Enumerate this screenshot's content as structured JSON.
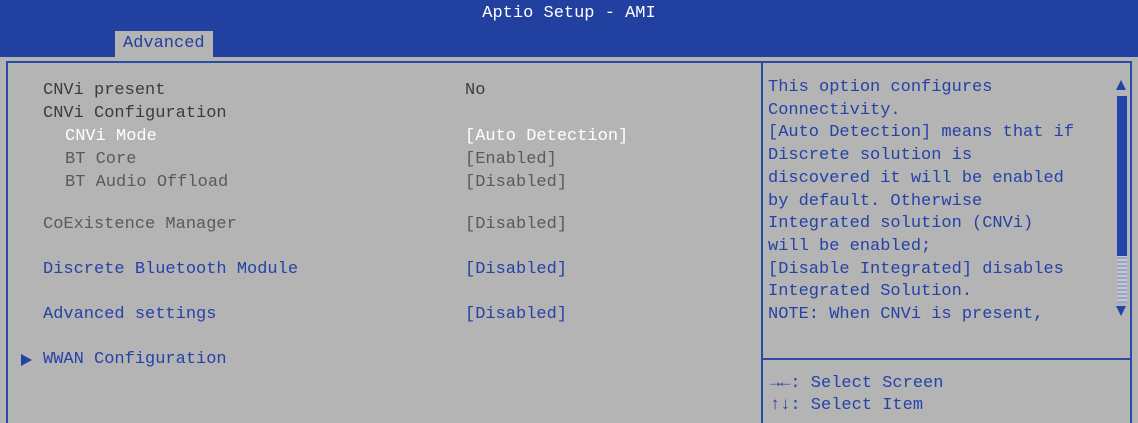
{
  "window": {
    "title": "Aptio Setup - AMI"
  },
  "tabs": [
    {
      "label": "Advanced",
      "active": true
    }
  ],
  "settings": [
    {
      "label": "CNVi present",
      "value": "No"
    },
    {
      "label": "CNVi Configuration",
      "value": ""
    },
    {
      "label": "CNVi Mode",
      "value": "[Auto Detection]",
      "selected": true
    },
    {
      "label": "BT Core",
      "value": "[Enabled]"
    },
    {
      "label": "BT Audio Offload",
      "value": "[Disabled]"
    },
    {
      "label": "CoExistence Manager",
      "value": "[Disabled]"
    },
    {
      "label": "Discrete Bluetooth Module",
      "value": "[Disabled]"
    },
    {
      "label": "Advanced settings",
      "value": "[Disabled]"
    },
    {
      "label": "WWAN Configuration",
      "value": ""
    }
  ],
  "help": {
    "lines": [
      "This option configures",
      "Connectivity.",
      "[Auto Detection] means that if",
      "Discrete solution is",
      "discovered it will be enabled",
      "by default. Otherwise",
      "Integrated solution (CNVi)",
      "will be enabled;",
      "[Disable Integrated] disables",
      "Integrated Solution.",
      "NOTE: When CNVi is present,"
    ]
  },
  "key_help": {
    "lines": [
      "→←: Select Screen",
      "↑↓: Select Item"
    ]
  },
  "colors": {
    "header": "#2240a0",
    "background": "#b4b4b4",
    "accent": "#2442a8",
    "selected_text": "#ffffff"
  },
  "icons": [
    "submenu-arrow-icon",
    "scroll-up-icon",
    "scroll-down-icon"
  ]
}
